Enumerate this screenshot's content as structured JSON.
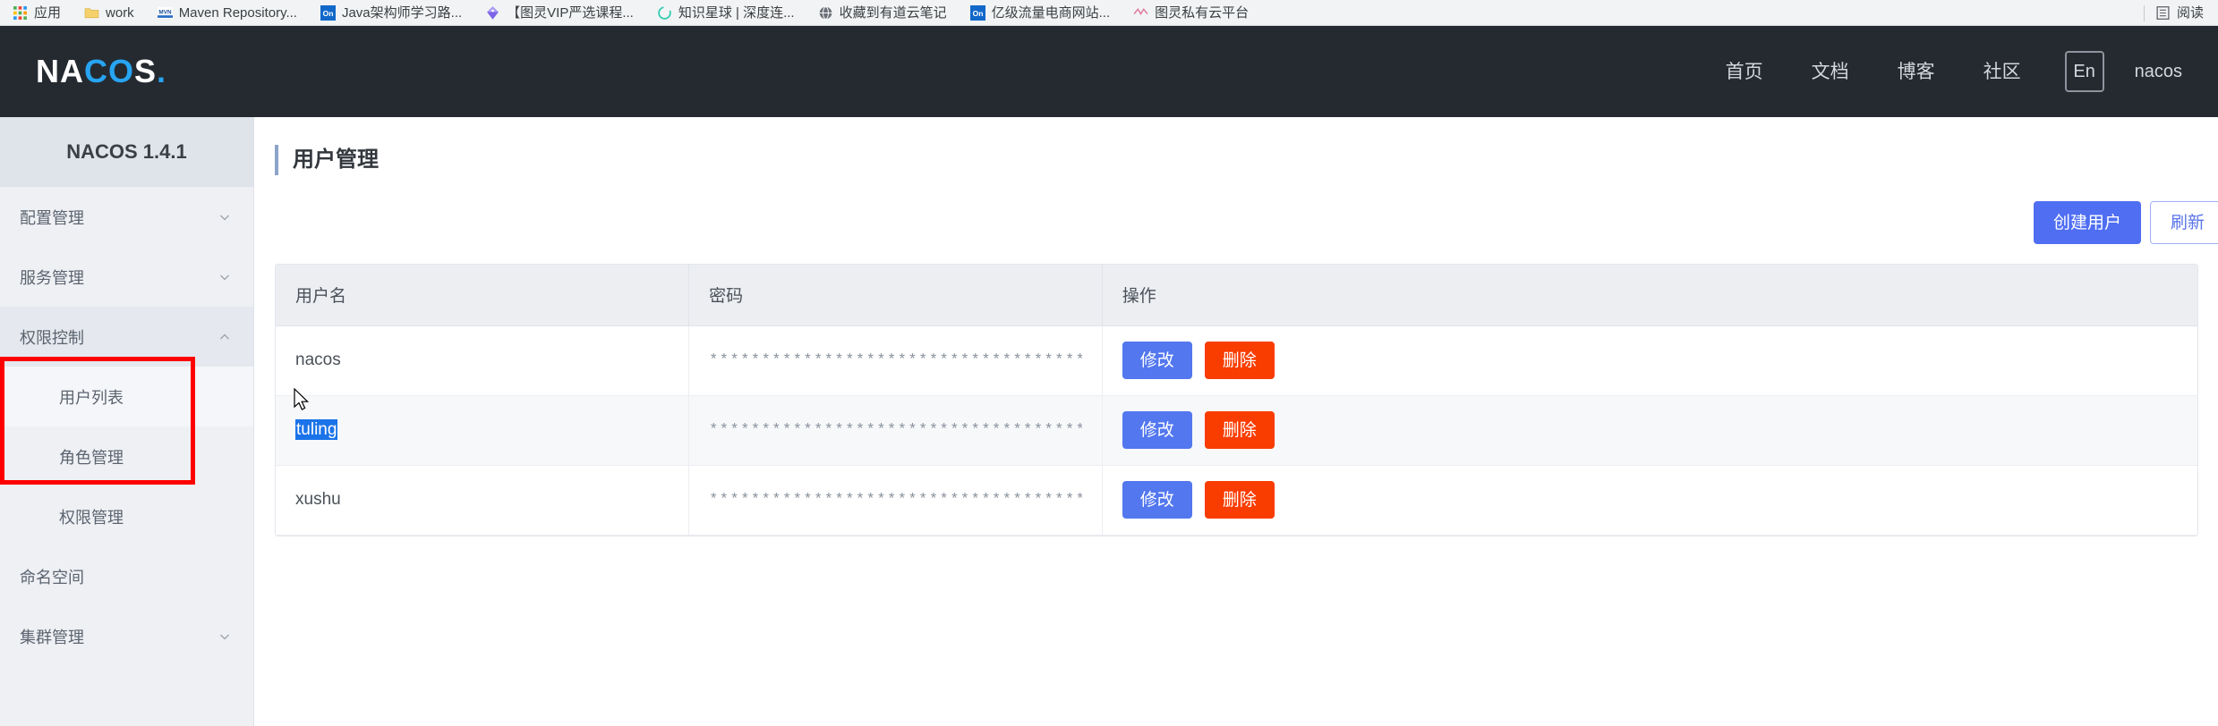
{
  "browser": {
    "bookmarks": [
      {
        "label": "应用",
        "icon": "apps-grid-icon"
      },
      {
        "label": "work",
        "icon": "folder-icon"
      },
      {
        "label": "Maven Repository...",
        "icon": "mvn-icon"
      },
      {
        "label": "Java架构师学习路...",
        "icon": "on-icon"
      },
      {
        "label": "【图灵VIP严选课程...",
        "icon": "diamond-icon"
      },
      {
        "label": "知识星球 | 深度连...",
        "icon": "circle-arrow-icon"
      },
      {
        "label": "收藏到有道云笔记",
        "icon": "globe-icon"
      },
      {
        "label": "亿级流量电商网站...",
        "icon": "on-icon"
      },
      {
        "label": "图灵私有云平台",
        "icon": "ribbon-icon"
      }
    ],
    "right_items": [
      {
        "label": "阅读",
        "icon": "reading-list-icon"
      }
    ]
  },
  "header": {
    "logo": {
      "part1": "NA",
      "part2": "CO",
      "part3": "S",
      "dot": "."
    },
    "nav": [
      {
        "label": "首页"
      },
      {
        "label": "文档"
      },
      {
        "label": "博客"
      },
      {
        "label": "社区"
      }
    ],
    "language_toggle": "En",
    "user": "nacos"
  },
  "sidebar": {
    "title": "NACOS 1.4.1",
    "items": [
      {
        "label": "配置管理",
        "icon": "chevron-down-icon",
        "expandable": true,
        "expanded": false
      },
      {
        "label": "服务管理",
        "icon": "chevron-down-icon",
        "expandable": true,
        "expanded": false
      },
      {
        "label": "权限控制",
        "icon": "chevron-up-icon",
        "expandable": true,
        "expanded": true
      },
      {
        "label": "命名空间",
        "icon": "",
        "expandable": false,
        "expanded": false
      },
      {
        "label": "集群管理",
        "icon": "chevron-down-icon",
        "expandable": true,
        "expanded": false
      }
    ],
    "sub_items": [
      {
        "label": "用户列表",
        "active": true
      },
      {
        "label": "角色管理",
        "active": false
      },
      {
        "label": "权限管理",
        "active": false
      }
    ],
    "annotation_color": "#ff0000"
  },
  "main": {
    "page_title": "用户管理",
    "buttons": {
      "create": "创建用户",
      "refresh": "刷新"
    },
    "table": {
      "columns": [
        "用户名",
        "密码",
        "操作"
      ],
      "rows": [
        {
          "username": "nacos",
          "password": "****************************************************************",
          "actions": {
            "edit": "修改",
            "delete": "删除"
          },
          "selected": false,
          "hovered": false
        },
        {
          "username": "tuling",
          "password": "****************************************************************",
          "actions": {
            "edit": "修改",
            "delete": "删除"
          },
          "selected": true,
          "hovered": true
        },
        {
          "username": "xushu",
          "password": "****************************************************************",
          "actions": {
            "edit": "修改",
            "delete": "删除"
          },
          "selected": false,
          "hovered": false
        }
      ]
    }
  },
  "colors": {
    "header_bg": "#252a31",
    "logo_accent": "#27a4f2",
    "primary_blue": "#4f6ef2",
    "delete_red": "#f93c00",
    "selection_blue": "#1a73e8",
    "sidebar_bg": "#eef0f4"
  }
}
